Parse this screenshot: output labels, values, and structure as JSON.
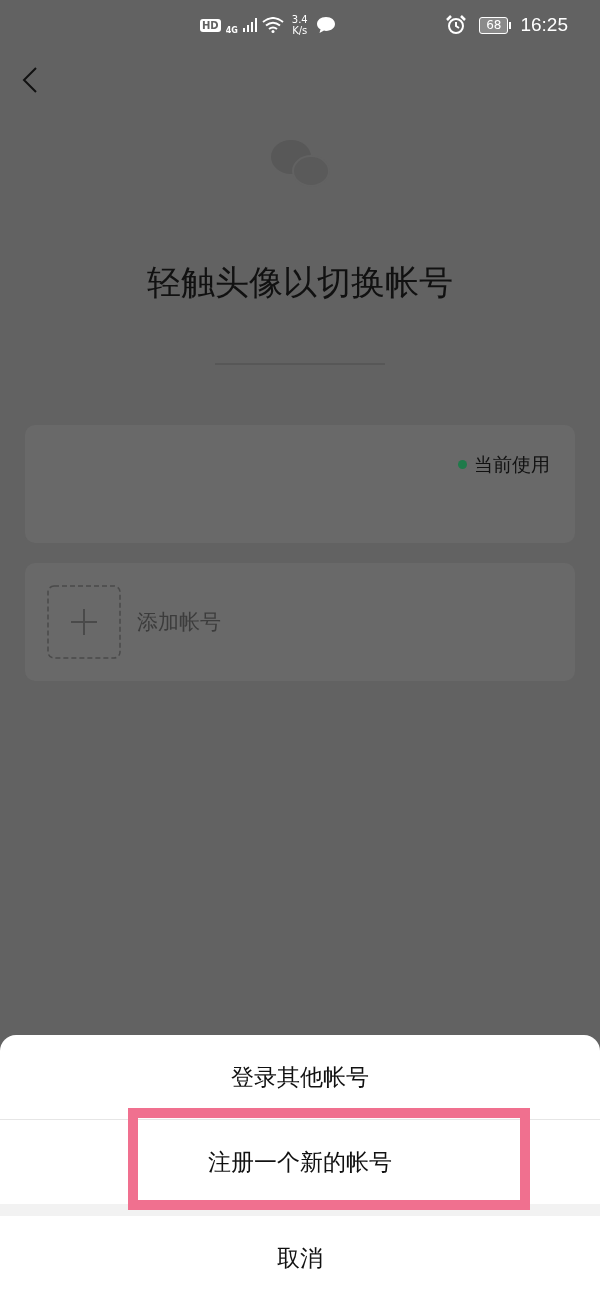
{
  "status_bar": {
    "hd": "HD",
    "network": "4G",
    "speed_value": "3.4",
    "speed_unit": "K/s",
    "battery": "68",
    "time": "16:25"
  },
  "title": "轻触头像以切换帐号",
  "accounts": [
    {
      "kind": "current",
      "badge": "当前使用",
      "color": "#1f7a4a"
    },
    {
      "kind": "add",
      "label": "添加帐号"
    }
  ],
  "sheet": {
    "options": [
      {
        "label": "登录其他帐号",
        "highlighted": false
      },
      {
        "label": "注册一个新的帐号",
        "highlighted": true
      }
    ],
    "cancel": "取消"
  }
}
